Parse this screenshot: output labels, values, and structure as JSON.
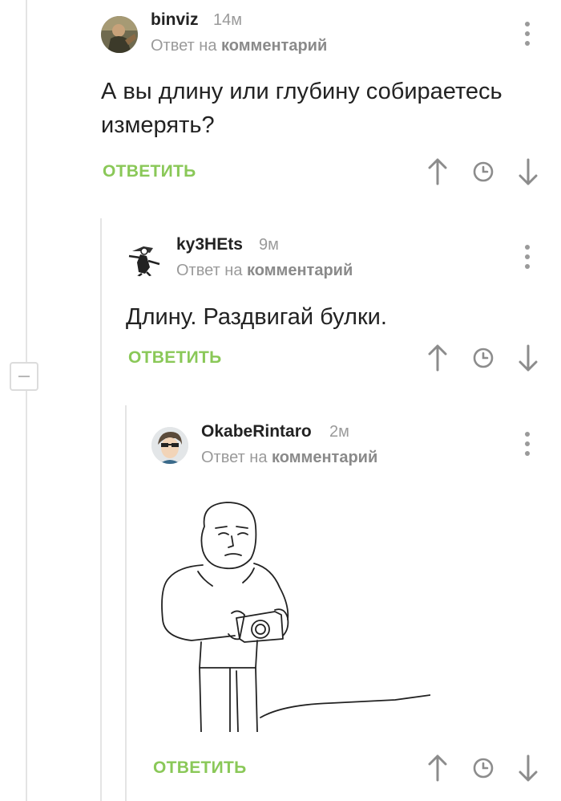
{
  "labels": {
    "reply_to": "Ответ на",
    "comment": "комментарий",
    "reply_button": "ОТВЕТИТЬ"
  },
  "comments": [
    {
      "author": "binviz",
      "time": "14м",
      "text": "А вы длину или глубину собираетесь измерять?"
    },
    {
      "author": "ky3HEts",
      "time": "9м",
      "text": "Длину. Раздвигай булки."
    },
    {
      "author": "OkabeRintaro",
      "time": "2м",
      "text": ""
    }
  ],
  "icons": {
    "upvote": "arrow-up-icon",
    "save": "clock-icon",
    "downvote": "arrow-down-icon",
    "menu": "more-vertical-icon",
    "collapse": "minus-icon"
  },
  "colors": {
    "reply_button": "#8ac858",
    "meta": "#9a9a9a",
    "icon": "#8c8c8c"
  }
}
